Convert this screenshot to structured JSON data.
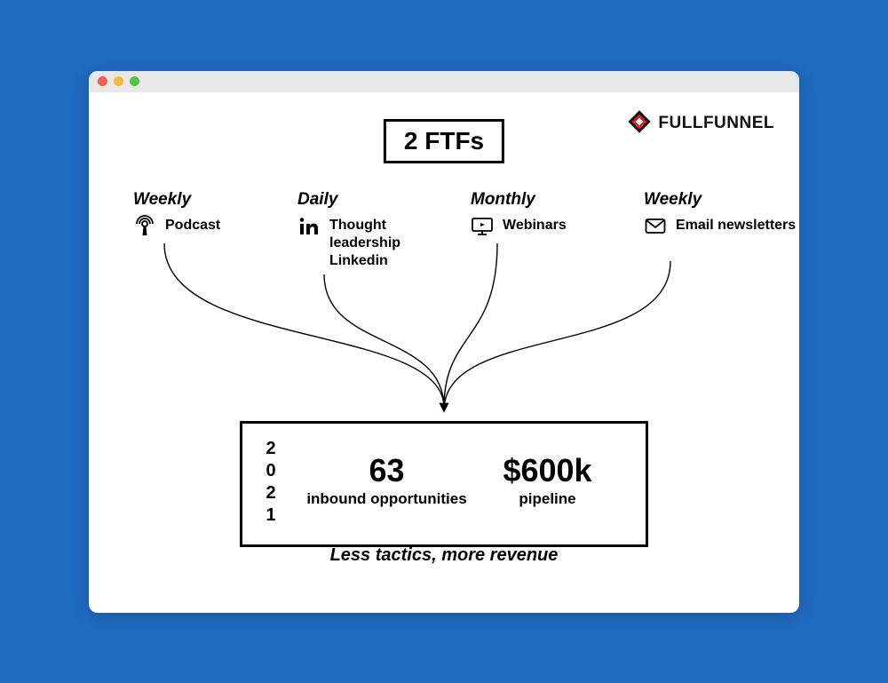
{
  "logo_text": "FULLFUNNEL",
  "ftf_title": "2 FTFs",
  "channels": [
    {
      "frequency": "Weekly",
      "label": "Podcast"
    },
    {
      "frequency": "Daily",
      "label": "Thought leadership Linkedin"
    },
    {
      "frequency": "Monthly",
      "label": "Webinars"
    },
    {
      "frequency": "Weekly",
      "label": "Email newsletters"
    }
  ],
  "result": {
    "year_digits": [
      "2",
      "0",
      "2",
      "1"
    ],
    "stat1_big": "63",
    "stat1_small": "inbound opportunities",
    "stat2_big": "$600k",
    "stat2_small": "pipeline"
  },
  "tagline": "Less tactics, more revenue"
}
